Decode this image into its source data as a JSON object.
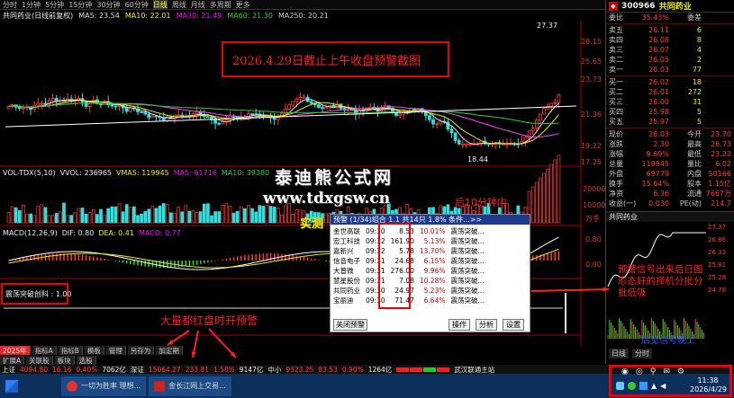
{
  "toolbar": {
    "periods": [
      "分时",
      "1分钟",
      "5分钟",
      "15分钟",
      "30分钟",
      "60分钟",
      "日线",
      "周线",
      "月线",
      "多周期",
      "更多"
    ],
    "active_index": 6,
    "title": "共同药业(日线前复权)"
  },
  "ma_legend": {
    "ma5": "MA5: 23.54",
    "ma10": "MA10: 22.01",
    "ma30": "MA30: 21.49",
    "ma60": "MA60: 21.30",
    "ma250": "MA250: 20.21"
  },
  "price_axis": [
    "28.15",
    "25.65",
    "23.73",
    "21.36",
    "19.22",
    "17.25"
  ],
  "price_marks": {
    "high": "27.37",
    "low": "18.44"
  },
  "annotation_top": "2026.4.29日截止上午收盘预警截图",
  "watermark_1": "泰迪熊公式网",
  "watermark_2": "www.tdxgsw.cn",
  "watermark_3": "实测",
  "watermark_4": "后10分钟内",
  "vol_legend": {
    "label": "VOL-TDX(5,10)",
    "vvol": "VVOL: 236965",
    "vma5": "VMA5: 119945",
    "vma10": "MA5: 61716",
    "vma20": "MA10: 39380"
  },
  "vol_axis": [
    "20000",
    "10000",
    "万手"
  ],
  "macd_legend": {
    "label": "MACD(12,26,9)",
    "dif": "DIF: 0.80",
    "dea": "DEA: 0.41",
    "macd": "MACD: 0.77"
  },
  "macd_axis": [
    "0.80",
    "0.00"
  ],
  "indicator_label": "震荡突破创科 : 1.00",
  "annotation_bottom": "大量都红盘时开预警",
  "popup": {
    "title": "预警 (1/34)组合 1.1 共14只 1.8% 条件...>>",
    "rows": [
      {
        "name": "金世高联",
        "time": "09:30",
        "price": "8.53",
        "pct": "10.01%",
        "type": "震荡突破..."
      },
      {
        "name": "宏工科技",
        "time": "09:32",
        "price": "161.90",
        "pct": "5.13%",
        "type": "震荡突破..."
      },
      {
        "name": "嘉新兴",
        "time": "09:32",
        "price": "5.78",
        "pct": "13.70%",
        "type": "震荡突破..."
      },
      {
        "name": "信音电子",
        "time": "09:31",
        "price": "24.68",
        "pct": "6.15%",
        "type": "震荡突破..."
      },
      {
        "name": "大普微",
        "time": "09:31",
        "price": "276.00",
        "pct": "9.96%",
        "type": "震荡突破..."
      },
      {
        "name": "慧星股份",
        "time": "09:31",
        "price": "7.08",
        "pct": "10.28%",
        "type": "震荡突破..."
      },
      {
        "name": "共同药业",
        "time": "09:30",
        "price": "24.97",
        "pct": "5.23%",
        "type": "震荡突破..."
      },
      {
        "name": "宝丽迪",
        "time": "09:30",
        "price": "71.47",
        "pct": "6.64%",
        "type": "震荡突破..."
      }
    ],
    "btn_close": "关闭预警",
    "btn_op": "操作",
    "btn_analysis": "分析",
    "btn_settings": "设置"
  },
  "right_panel": {
    "code": "300966",
    "name": "共同药业",
    "webi_label": "委比",
    "webi_value": "35.43%",
    "wecha_label": "委差",
    "sell": [
      {
        "label": "卖五",
        "price": "26.11",
        "vol": "6"
      },
      {
        "label": "卖四",
        "price": "26.08",
        "vol": "8"
      },
      {
        "label": "卖三",
        "price": "26.07",
        "vol": "4"
      },
      {
        "label": "卖二",
        "price": "26.05",
        "vol": "2"
      },
      {
        "label": "卖一",
        "price": "26.03",
        "vol": "77"
      }
    ],
    "buy": [
      {
        "label": "买一",
        "price": "26.02",
        "vol": "18"
      },
      {
        "label": "买二",
        "price": "26.01",
        "vol": "272"
      },
      {
        "label": "买三",
        "price": "26.00",
        "vol": "31"
      },
      {
        "label": "买四",
        "price": "25.98",
        "vol": "5"
      },
      {
        "label": "买五",
        "price": "25.97",
        "vol": "5"
      }
    ],
    "stats": [
      {
        "l1": "现价",
        "v1": "26.03",
        "l2": "今开",
        "v2": "23.70"
      },
      {
        "l1": "涨跌",
        "v1": "2.30",
        "l2": "最高",
        "v2": "26.73"
      },
      {
        "l1": "涨幅",
        "v1": "9.69%",
        "l2": "最低",
        "v2": "23.22"
      },
      {
        "l1": "总量",
        "v1": "119945",
        "l2": "量比",
        "v2": "6.02"
      },
      {
        "l1": "外盘",
        "v1": "69779",
        "l2": "内盘",
        "v2": "50166"
      },
      {
        "l1": "换手",
        "v1": "15.64%",
        "l2": "股本",
        "v2": "1.15亿"
      },
      {
        "l1": "净资",
        "v1": "6.36",
        "l2": "流通",
        "v2": "7667万"
      },
      {
        "l1": "收益(一)",
        "v1": "0.030",
        "l2": "PE(动)",
        "v2": "214.7"
      }
    ],
    "mini_title": "共同药业",
    "mini_axis": [
      "27.37",
      "26.86",
      "26.33",
      "25.81",
      "25.28",
      "24.78"
    ],
    "annotation": "预警信号出来后日图形态好的择机分批分批低吸",
    "annotation_2": "后见信号晚上",
    "bottom_tabs": [
      "日线",
      "分时"
    ]
  },
  "bottom_tabs": [
    "2025年",
    "指标A",
    "指标B",
    "模板",
    "管理",
    "另存为",
    "加定期"
  ],
  "bottom_tabs2": [
    "扩展A",
    "关联股",
    "板块",
    "选股"
  ],
  "status": {
    "sh_label": "上证",
    "sh_value": "4094.80",
    "sh_chg": "16.16",
    "sh_pct": "0.40%",
    "sh_amt": "7062亿",
    "sz_label": "深证",
    "sz_value": "15064.27",
    "sz_chg": "233.81",
    "sz_pct": "1.58%",
    "sz_amt": "9147亿",
    "zx_label": "中小",
    "zx_value": "9323.25",
    "zx_chg": "83.53",
    "zx_pct": "0.90%",
    "zx_amt": "1264亿",
    "site": "武汉联通主站"
  },
  "taskbar": {
    "task1": "一切为胜率 理想...",
    "task2": "金长江网上交易...",
    "time": "11:38",
    "date": "2026/4/29"
  },
  "colors": {
    "up": "#ff3b3b",
    "down": "#33cc33",
    "accent": "#ffee00",
    "annot": "#e00000"
  }
}
